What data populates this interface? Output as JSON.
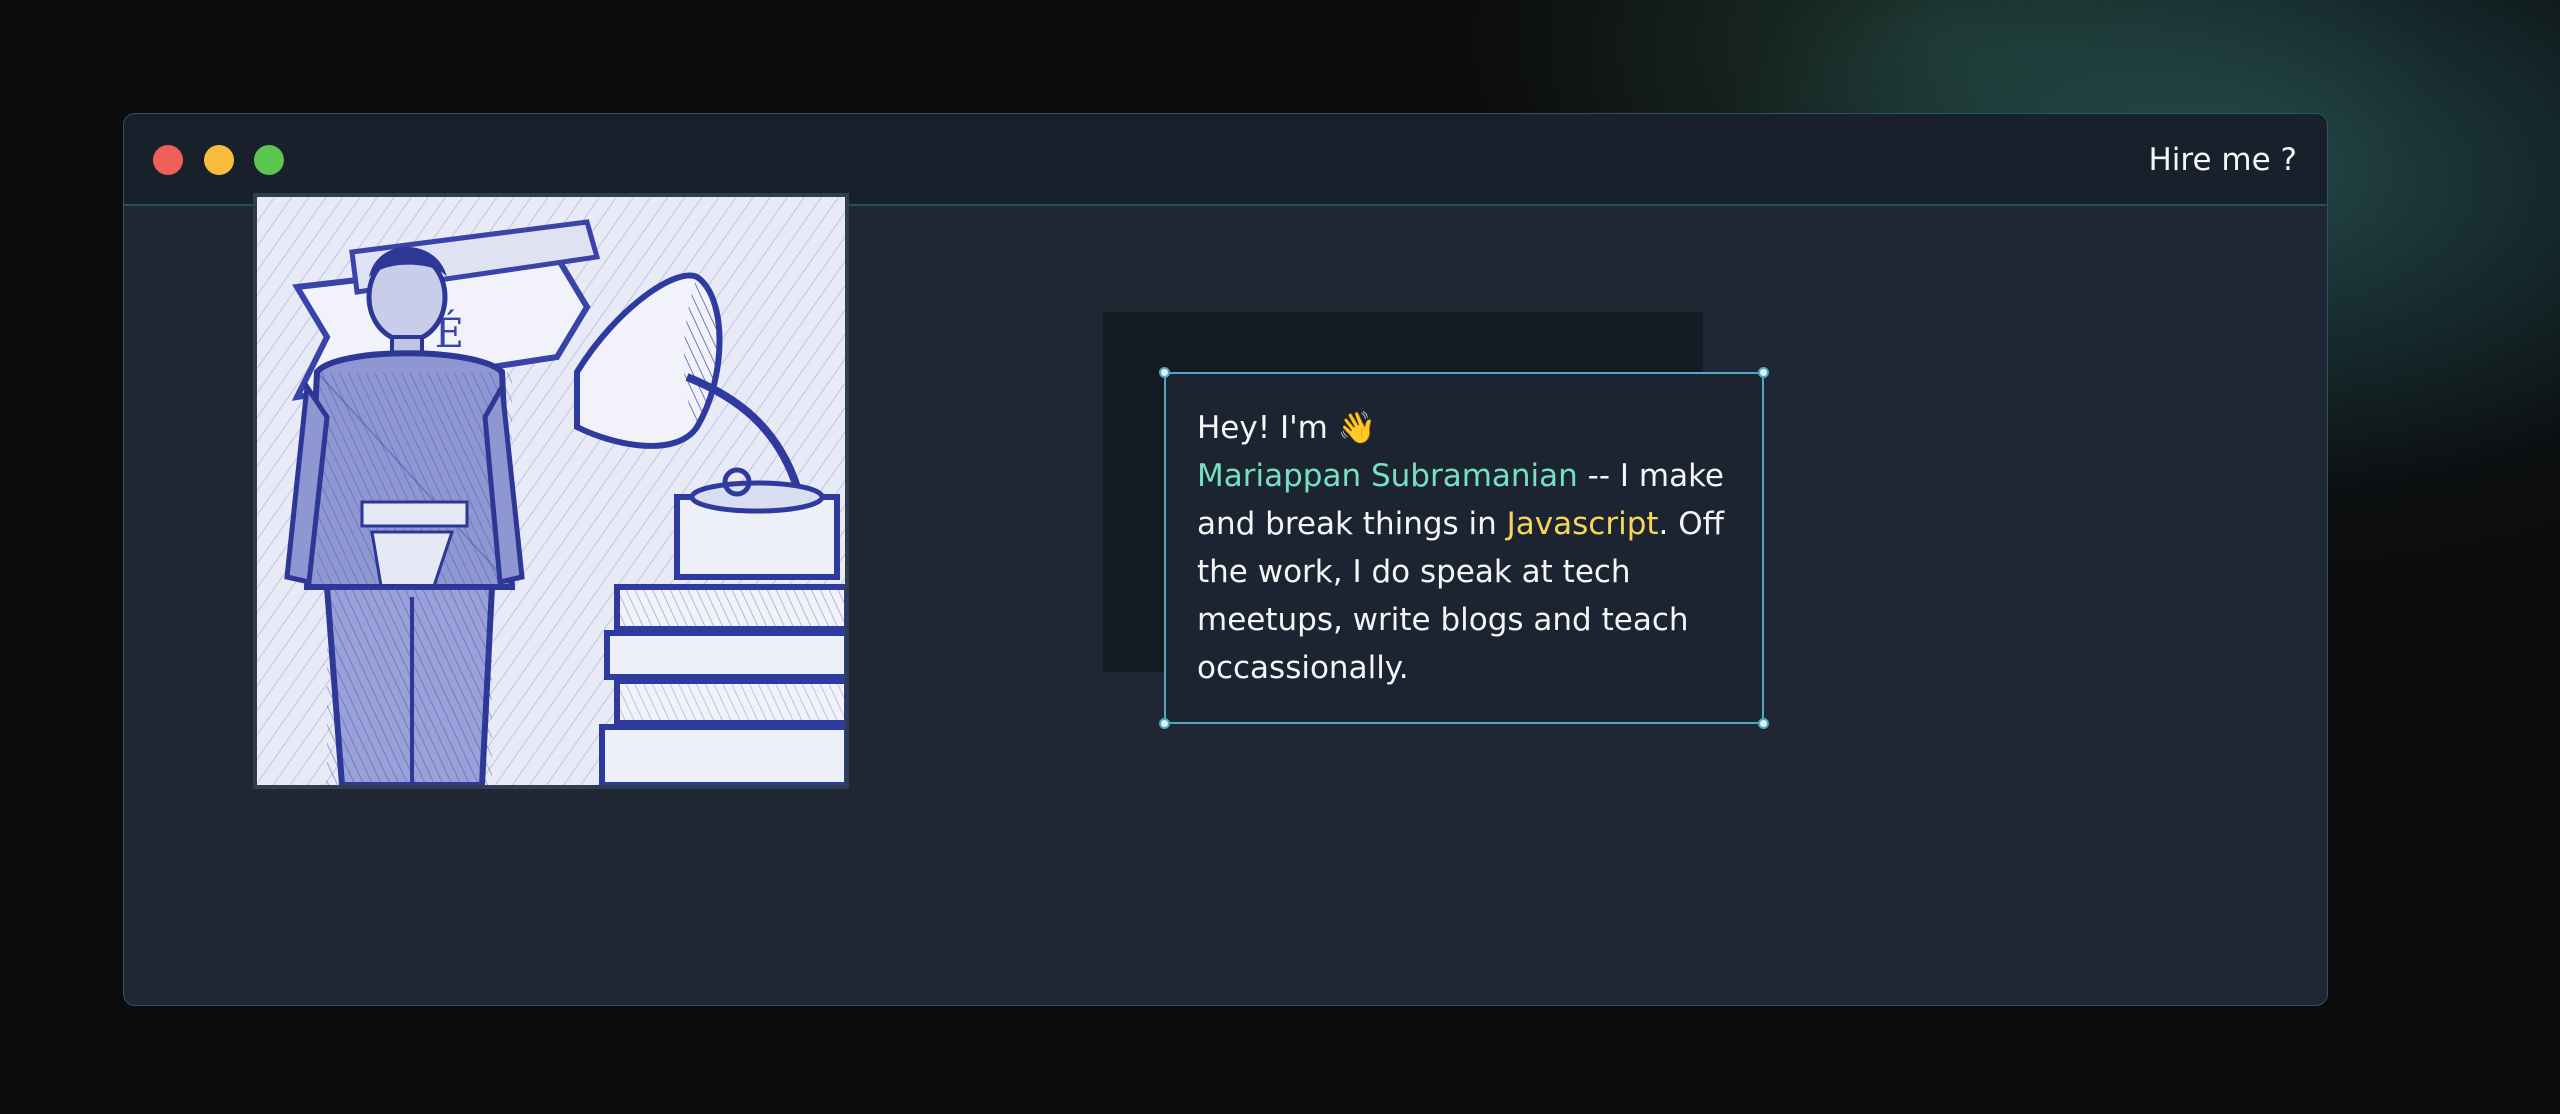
{
  "window": {
    "title_link": "Hire me ?",
    "controls": [
      "close",
      "minimize",
      "maximize"
    ]
  },
  "photo": {
    "alt": "Sketch-style portrait of a man beside a gramophone and books"
  },
  "intro": {
    "greeting": "Hey! I'm 👋",
    "name": "Mariappan Subramanian",
    "text_before_lang": " -- I make and break things in ",
    "language": "Javascript",
    "text_after_lang": ". Off the work, I do speak at tech meetups, write blogs and teach occassionally."
  },
  "colors": {
    "accent_name": "#76e0c0",
    "accent_language": "#f7d55a",
    "selection_border": "#4fa9c2",
    "window_bg": "#1e2733",
    "titlebar_bg": "#17202b"
  }
}
